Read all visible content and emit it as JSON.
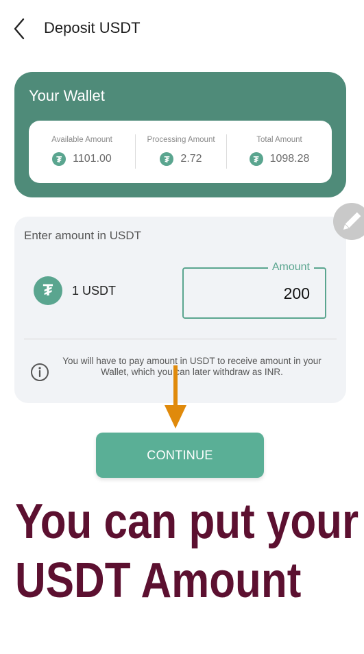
{
  "header": {
    "title": "Deposit USDT",
    "back_icon": "chevron-left-icon"
  },
  "wallet": {
    "title": "Your Wallet",
    "coin_symbol": "₮",
    "stats": [
      {
        "label": "Available Amount",
        "value": "1101.00"
      },
      {
        "label": "Processing Amount",
        "value": "2.72"
      },
      {
        "label": "Total Amount",
        "value": "1098.28"
      }
    ]
  },
  "amount_form": {
    "label": "Enter amount in USDT",
    "unit_label": "1 USDT",
    "field_legend": "Amount",
    "field_value": "200",
    "info_text": "You will have to pay amount in USDT to receive amount in your Wallet, which you can later withdraw as INR."
  },
  "continue_label": "CONTINUE",
  "overlay_caption": {
    "line1": "You can put your",
    "line2": "USDT Amount"
  },
  "colors": {
    "primary": "#4f8b79",
    "accent": "#5aa58f",
    "button": "#5aaf96",
    "caption": "#5c1030",
    "arrow": "#e08a0b"
  }
}
